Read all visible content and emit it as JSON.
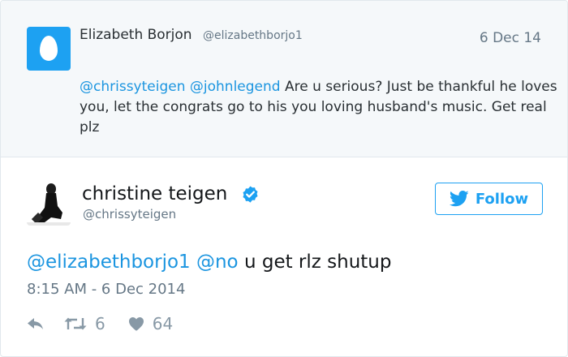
{
  "parent_tweet": {
    "author_name": "Elizabeth Borjon",
    "author_handle": "@elizabethborjo1",
    "date": "6 Dec 14",
    "mention_1": "@chrissyteigen",
    "mention_2": "@johnlegend",
    "text": "Are u serious? Just be thankful he loves you, let the congrats go to his you loving husband's music. Get real plz",
    "avatar_icon": "default-egg-icon"
  },
  "tweet": {
    "author_name": "christine teigen",
    "author_handle": "@chrissyteigen",
    "verified_icon": "verified-badge-icon",
    "follow_label": "Follow",
    "mention_1": "@elizabethborjo1",
    "mention_2": "@no",
    "text": "u get rlz shutup",
    "timestamp": "8:15 AM - 6 Dec 2014",
    "retweet_count": "6",
    "like_count": "64"
  },
  "colors": {
    "accent": "#1da1f2",
    "mention": "#1b95e0",
    "muted": "#657786",
    "parent_bg": "#f5f8fa"
  }
}
